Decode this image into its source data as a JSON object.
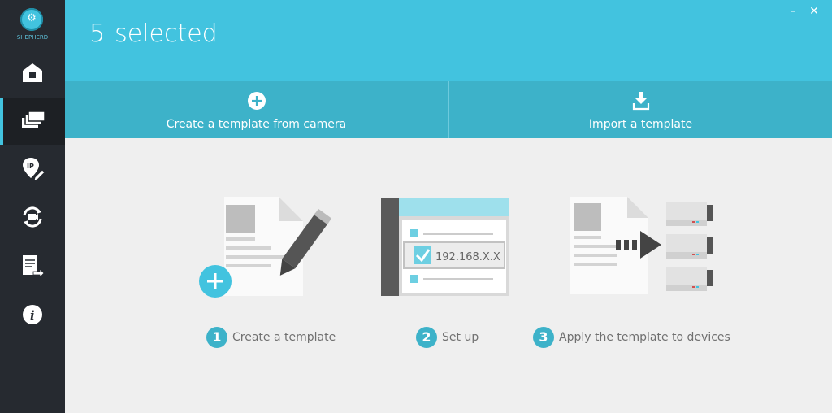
{
  "app": {
    "logo_text": "SHEPHERD"
  },
  "header": {
    "count": "5",
    "title": "selected"
  },
  "window_controls": {
    "minimize": "–",
    "close": "✕"
  },
  "sidebar": {
    "items": [
      {
        "name": "home",
        "active": false
      },
      {
        "name": "devices",
        "active": true
      },
      {
        "name": "ip",
        "active": false
      },
      {
        "name": "update",
        "active": false
      },
      {
        "name": "export",
        "active": false
      },
      {
        "name": "info",
        "active": false
      }
    ]
  },
  "actions": {
    "create_label": "Create a template from camera",
    "import_label": "Import a template"
  },
  "steps": [
    {
      "number": "1",
      "label": "Create a template"
    },
    {
      "number": "2",
      "label": "Set up",
      "ip_text": "192.168.X.X"
    },
    {
      "number": "3",
      "label": "Apply the template to devices"
    }
  ],
  "colors": {
    "accent": "#42c3df",
    "bar": "#3db2c9",
    "sidebar": "#262a30"
  }
}
